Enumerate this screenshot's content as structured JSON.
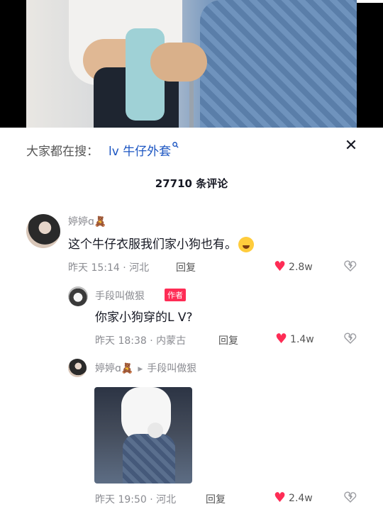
{
  "search": {
    "prefix": "大家都在搜：",
    "term": "lv 牛仔外套",
    "close": "✕"
  },
  "comments_header": {
    "count_text": "27710 条评论"
  },
  "comments": [
    {
      "username": "婷婷ɑ",
      "text": "这个牛仔衣服我们家小狗也有。",
      "time": "昨天 15:14 · 河北",
      "reply": "回复",
      "likes": "2.8w"
    },
    {
      "username": "手段叫做狠",
      "badge": "作者",
      "text": "你家小狗穿的L V?",
      "time": "昨天 18:38 · 内蒙古",
      "reply": "回复",
      "likes": "1.4w"
    },
    {
      "username": "婷婷ɑ",
      "reply_to": "手段叫做狠",
      "time": "昨天 19:50 · 河北",
      "reply": "回复",
      "likes": "2.4w"
    }
  ],
  "colors": {
    "accent": "#fe2c55",
    "link": "#1b55c2",
    "meta": "#8a8b91"
  }
}
